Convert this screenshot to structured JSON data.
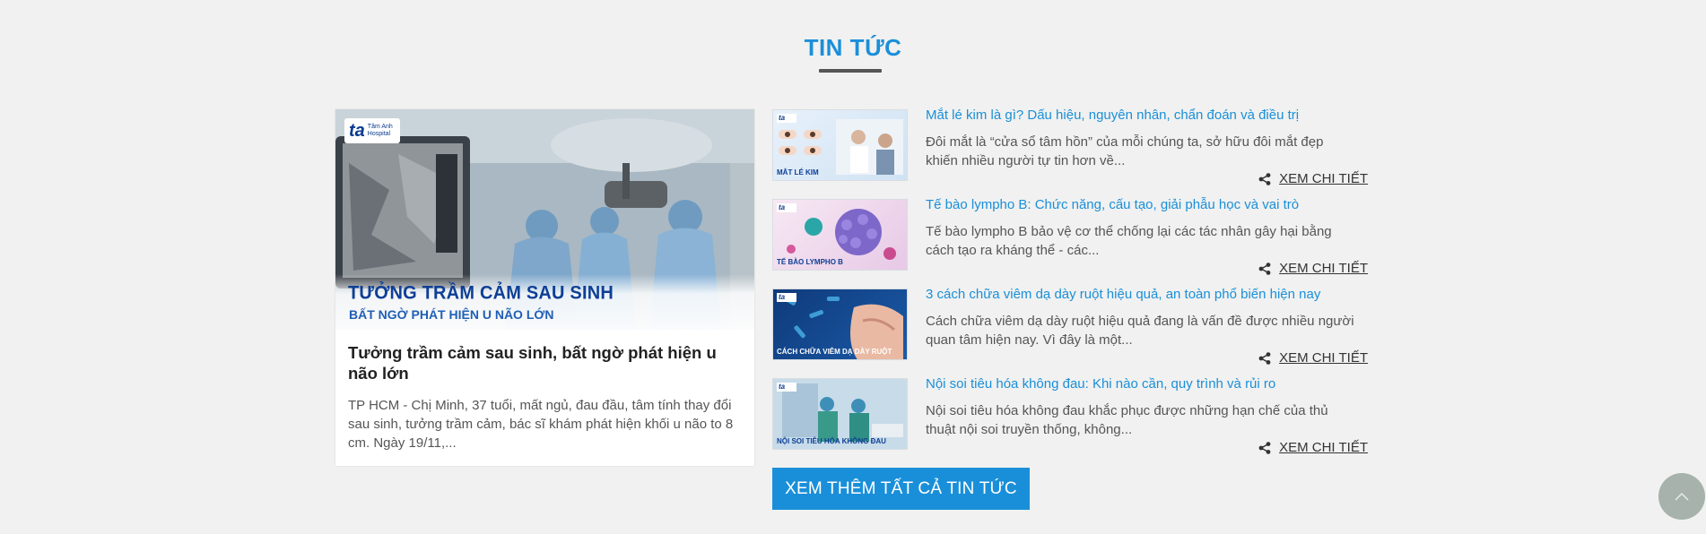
{
  "section": {
    "title": "TIN TỨC"
  },
  "featured": {
    "banner_title": "TƯỞNG TRẦM CẢM SAU SINH",
    "banner_subtitle": "BẤT NGỜ PHÁT HIỆN U NÃO LỚN",
    "brand_short": "ta",
    "brand_name_1": "Tâm Anh",
    "brand_name_2": "Hospital",
    "title": "Tưởng trầm cảm sau sinh, bất ngờ phát hiện u não lớn",
    "excerpt": "TP HCM - Chị Minh, 37 tuổi, mất ngủ, đau đầu, tâm tính thay đổi sau sinh, tưởng trầm cảm, bác sĩ khám phát hiện khối u não to 8 cm. Ngày 19/11,..."
  },
  "news": [
    {
      "title": "Mắt lé kim là gì? Dấu hiệu, nguyên nhân, chẩn đoán và điều trị",
      "excerpt": "Đôi mắt là “cửa sổ tâm hồn” của mỗi chúng ta, sở hữu đôi mắt đẹp khiến nhiều người tự tin hơn về...",
      "thumb_caption": "MẮT LÉ KIM",
      "link": "XEM CHI TIẾT"
    },
    {
      "title": "Tế bào lympho B: Chức năng, cấu tạo, giải phẫu học và vai trò",
      "excerpt": "Tế bào lympho B bảo vệ cơ thể chống lại các tác nhân gây hại bằng cách tạo ra kháng thể - các...",
      "thumb_caption": "TẾ BÀO LYMPHO B",
      "link": "XEM CHI TIẾT"
    },
    {
      "title": "3 cách chữa viêm dạ dày ruột hiệu quả, an toàn phổ biến hiện nay",
      "excerpt": "Cách chữa viêm dạ dày ruột hiệu quả đang là vấn đề được nhiều người quan tâm hiện nay. Vì đây là một...",
      "thumb_caption": "CÁCH CHỮA VIÊM DẠ DÀY RUỘT",
      "link": "XEM CHI TIẾT"
    },
    {
      "title": "Nội soi tiêu hóa không đau: Khi nào cần, quy trình và rủi ro",
      "excerpt": "Nội soi tiêu hóa không đau khắc phục được những hạn chế của thủ thuật nội soi truyền thống, không...",
      "thumb_caption": "NỘI SOI TIÊU HÓA KHÔNG ĐAU",
      "link": "XEM CHI TIẾT"
    }
  ],
  "more_button": "XEM THÊM TẤT CẢ TIN TỨC",
  "colors": {
    "accent": "#1a8fd9",
    "background": "#f0f1f0",
    "brand_navy": "#0d3f96"
  },
  "icons": {
    "share": "share-icon",
    "scroll_top": "chevron-up-icon"
  }
}
